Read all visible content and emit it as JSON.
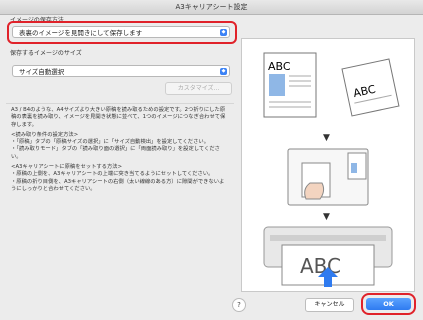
{
  "window": {
    "title": "A3キャリアシート設定"
  },
  "save_method": {
    "label": "イメージの保存方法",
    "value": "表裏のイメージを見開きにして保存します"
  },
  "save_size": {
    "label": "保存するイメージのサイズ",
    "value": "サイズ自動選択",
    "customize_button": "カスタマイズ..."
  },
  "description": {
    "p1": "A3 / B4のような、A4サイズより大きい原稿を読み取るための設定です。2つ折りにした原稿の表裏を読み取り、イメージを見開き状態に並べて、1つのイメージにつなぎ合わせて保存します。",
    "p2_heading": "<読み取り条件の設定方法>",
    "p2_line1": "・「原稿」タブの「原稿サイズの選択」に「サイズ自動検出」を設定してください。",
    "p2_line2": "・「読み取りモード」タブの「読み取り面の選択」に「両面読み取り」を設定してください。",
    "p3_heading": "<A3キャリアシートに原稿をセットする方法>",
    "p3_line1": "・原稿の上側を、A3キャリアシートの上端に突き当てるようにセットしてください。",
    "p3_line2": "・原稿の折り目側を、A3キャリアシートの右側（太い線線のある方）に隙間ができないようにしっかりと合わせてください。"
  },
  "illustration": {
    "abc_text_1": "ABC",
    "abc_text_2": "ABC",
    "abc_text_3": "ABC",
    "step_arrow": "▼"
  },
  "footer": {
    "help": "?",
    "cancel": "キャンセル",
    "ok": "OK"
  },
  "colors": {
    "highlight": "#e0222a",
    "accent": "#2f7bf0"
  }
}
